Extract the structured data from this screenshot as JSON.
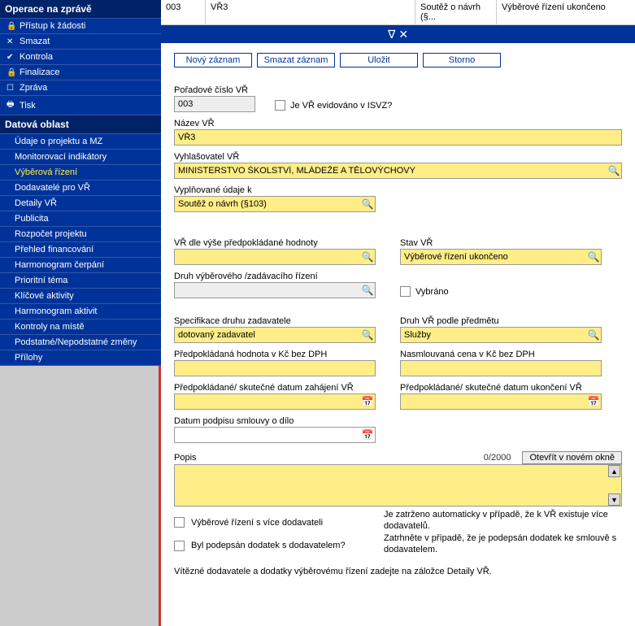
{
  "sidebar": {
    "header1": "Operace na zprávě",
    "ops": [
      {
        "icon": "🔒",
        "label": "Přístup k žádosti"
      },
      {
        "icon": "✕",
        "label": "Smazat"
      },
      {
        "icon": "✔",
        "label": "Kontrola"
      },
      {
        "icon": "🔒",
        "label": "Finalizace"
      },
      {
        "icon": "☐",
        "label": "Zpráva"
      },
      {
        "icon": "🖶",
        "label": "Tisk"
      }
    ],
    "header2": "Datová oblast",
    "data_items": [
      "Údaje o projektu a MZ",
      "Monitorovací indikátory",
      "Výběrová řízení",
      "Dodavatelé pro VŘ",
      "Detaily VŘ",
      "Publicita",
      "Rozpočet projektu",
      "Přehled financování",
      "Harmonogram čerpání",
      "Prioritní téma",
      "Klíčové aktivity",
      "Harmonogram aktivit",
      "Kontroly na místě",
      "Podstatné/Nepodstatné změny",
      "Přílohy"
    ],
    "active_index": 2
  },
  "grid": {
    "c1": "003",
    "c2": "VŘ3",
    "c3": "Soutěž o návrh (§...",
    "c4": "Výběrové řízení ukončeno"
  },
  "buttons": {
    "novy": "Nový záznam",
    "smazat": "Smazat záznam",
    "ulozit": "Uložit",
    "storno": "Storno"
  },
  "form": {
    "seq_label": "Pořadové číslo VŘ",
    "seq_value": "003",
    "isvz_label": "Je VŘ evidováno v ISVZ?",
    "nazev_label": "Název VŘ",
    "nazev_value": "VŘ3",
    "vyhl_label": "Vyhlašovatel VŘ",
    "vyhl_value": "MINISTERSTVO ŠKOLSTVÍ, MLÁDEŽE A TĚLOVÝCHOVY",
    "vypln_label": "Vyplňované údaje k",
    "vypln_value": "Soutěž o návrh (§103)",
    "vr_vyse_label": "VŘ dle výše předpokládané hodnoty",
    "vr_vyse_value": "",
    "stav_label": "Stav VŘ",
    "stav_value": "Výběrové řízení ukončeno",
    "druh_rizeni_label": "Druh výběrového /zadávacího řízení",
    "druh_rizeni_value": "",
    "vybrano_label": "Vybráno",
    "spec_label": "Specifikace druhu zadavatele",
    "spec_value": "dotovaný zadavatel",
    "druh_predmet_label": "Druh VŘ podle předmětu",
    "druh_predmet_value": "Služby",
    "predp_hodnota_label": "Předpokládaná hodnota v Kč bez DPH",
    "nasml_cena_label": "Nasmlouvaná cena v Kč bez DPH",
    "datum_zahaj_label": "Předpokládané/ skutečné datum zahájení VŘ",
    "datum_ukonc_label": "Předpokládané/ skutečné datum ukončení VŘ",
    "datum_podpis_label": "Datum podpisu smlouvy o dílo",
    "popis_label": "Popis",
    "popis_counter": "0/2000",
    "open_window": "Otevřít v novém okně",
    "vice_dod_label": "Výběrové řízení s více dodavateli",
    "vice_dod_note": "Je zatrženo automaticky v případě, že k VŘ existuje více dodavatelů.",
    "dodatek_label": "Byl podepsán dodatek s dodavatelem?",
    "dodatek_note": "Zatrhněte v případě, že je podepsán dodatek ke smlouvě s dodavatelem.",
    "footer": "Vítězné dodavatele a dodatky výběrovému řízení zadejte na záložce Detaily VŘ."
  }
}
